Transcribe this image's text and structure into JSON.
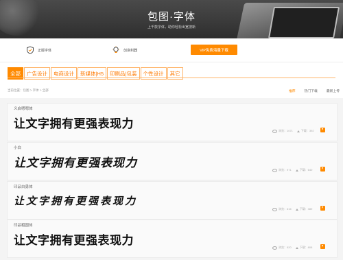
{
  "hero": {
    "title": "包图·字体",
    "subtitle": "上千款字体，助你轻松出宽搜新"
  },
  "features": [
    {
      "icon": "shield-icon",
      "label": "正版字体"
    },
    {
      "icon": "lightbulb-icon",
      "label": "创意利器"
    }
  ],
  "vip_button": "VIP免费海量下载",
  "tabs": [
    "全部",
    "广告设计",
    "电商设计",
    "新媒体|H5",
    "印刷品|包装",
    "个性设计",
    "其它"
  ],
  "active_tab": 0,
  "breadcrumb": "当前位置：包图 > 字体 > 全部",
  "sort": [
    "推荐",
    "热门下载",
    "最新上传"
  ],
  "sort_active": 0,
  "fonts": [
    {
      "name": "义启嗯嗯体",
      "sample": "让文字拥有更强表现力",
      "views": "浏览：1071",
      "downloads": "下载：392"
    },
    {
      "name": "小白",
      "sample": "让文字拥有更强表现力",
      "views": "浏览：971",
      "downloads": "下载：640"
    },
    {
      "name": "印品白勇体",
      "sample": "让文字拥有更强表现力",
      "views": "浏览：616",
      "downloads": "下载：389"
    },
    {
      "name": "印品粗圆体",
      "sample": "让文字拥有更强表现力",
      "views": "浏览：520",
      "downloads": "下载：808"
    }
  ],
  "colors": {
    "accent": "#ff8a00",
    "hero_bg": "#3a3a3a"
  }
}
